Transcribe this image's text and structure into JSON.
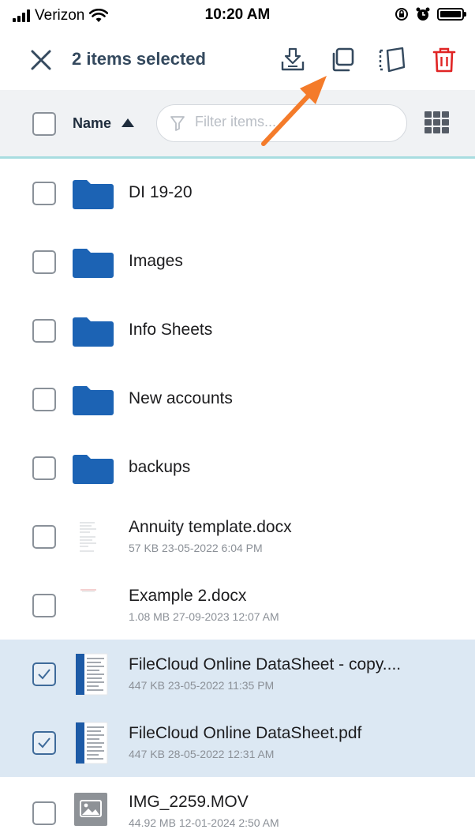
{
  "status_bar": {
    "carrier": "Verizon",
    "time": "10:20 AM"
  },
  "action_bar": {
    "selection_text": "2 items selected",
    "icons": [
      "close-icon",
      "download-icon",
      "copy-icon",
      "move-icon",
      "trash-icon"
    ],
    "delete_color": "#e02424"
  },
  "list_header": {
    "sort_label": "Name",
    "sort_direction": "ascending",
    "filter_placeholder": "Filter items..."
  },
  "files": [
    {
      "name": "DI 19-20",
      "type": "folder",
      "selected": false
    },
    {
      "name": "Images",
      "type": "folder",
      "selected": false
    },
    {
      "name": "Info Sheets",
      "type": "folder",
      "selected": false
    },
    {
      "name": "New accounts",
      "type": "folder",
      "selected": false
    },
    {
      "name": "backups",
      "type": "folder",
      "selected": false
    },
    {
      "name": "Annuity template.docx",
      "type": "document",
      "meta": "57 KB 23-05-2022 6:04 PM",
      "selected": false
    },
    {
      "name": "Example 2.docx",
      "type": "document",
      "meta": "1.08 MB 27-09-2023 12:07 AM",
      "selected": false
    },
    {
      "name": "FileCloud Online DataSheet - copy....",
      "type": "pdf",
      "meta": "447 KB 23-05-2022 11:35 PM",
      "selected": true
    },
    {
      "name": "FileCloud Online DataSheet.pdf",
      "type": "pdf",
      "meta": "447 KB 28-05-2022 12:31 AM",
      "selected": true
    },
    {
      "name": "IMG_2259.MOV",
      "type": "video",
      "meta": "44.92 MB 12-01-2024 2:50 AM",
      "selected": false
    }
  ],
  "colors": {
    "folder": "#1c63b4",
    "selected_row": "#dce8f3",
    "header_bg": "#f0f2f4",
    "accent_line": "#a8dde0",
    "annotation_arrow": "#f47b2a"
  }
}
